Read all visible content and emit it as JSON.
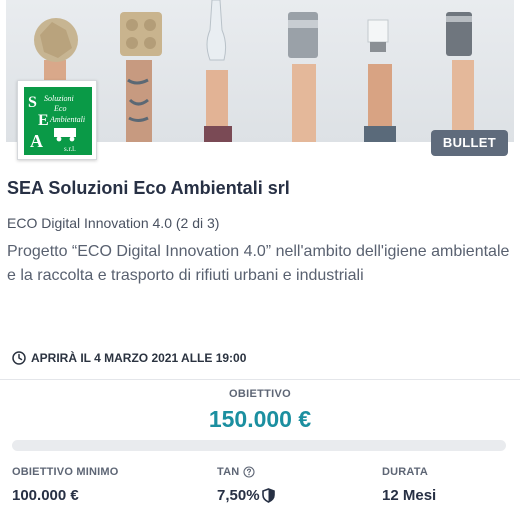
{
  "card": {
    "hero_image": "hands-holding-recyclables-image",
    "logo": {
      "letters": [
        "S",
        "E",
        "A"
      ],
      "text_lines": [
        "Soluzioni",
        "Eco",
        "Ambientali"
      ],
      "suffix": "s.r.l."
    },
    "badge": "BULLET",
    "title": "SEA Soluzioni Eco Ambientali srl",
    "subtitle": "ECO Digital Innovation 4.0 (2 di 3)",
    "description": "Progetto “ECO Digital Innovation 4.0” nell'ambito dell'igiene ambientale e la raccolta e trasporto di rifiuti urbani e industriali",
    "opens_text": "APRIRÀ IL 4 MARZO 2021 ALLE 19:00",
    "goal": {
      "label": "OBIETTIVO",
      "value": "150.000 €",
      "progress": 0
    },
    "stats": {
      "min_label": "OBIETTIVO MINIMO",
      "min_value": "100.000 €",
      "tan_label": "TAN",
      "tan_value": "7,50%",
      "duration_label": "DURATA",
      "duration_value": "12 Mesi"
    },
    "colors": {
      "accent": "#1b8fa0",
      "badge_bg": "#5f6b7c",
      "logo_green": "#0a9a47"
    }
  }
}
